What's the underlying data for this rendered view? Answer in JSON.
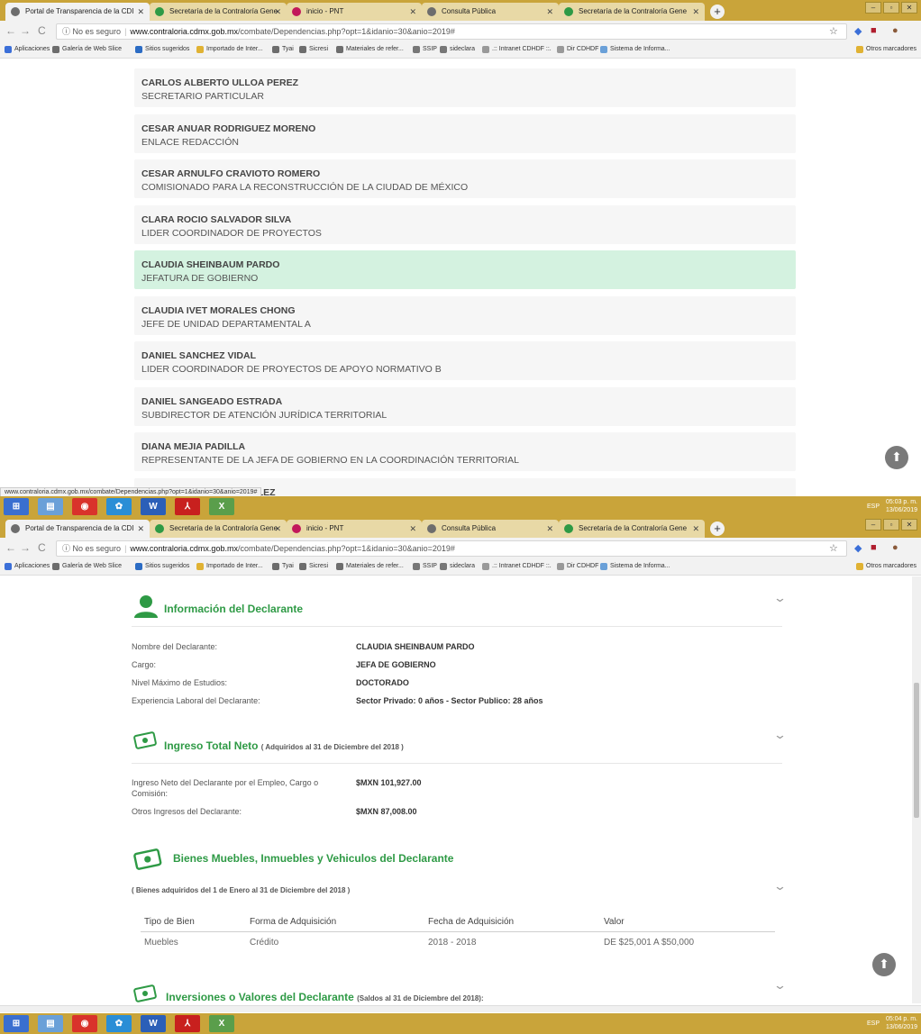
{
  "browser": {
    "tabs": [
      {
        "label": "Portal de Transparencia de la CDI",
        "fav": "#6d6d6d"
      },
      {
        "label": "Secretaría de la Contraloría Gene",
        "fav": "#2e9a45"
      },
      {
        "label": "inicio - PNT",
        "fav": "#c2185b"
      },
      {
        "label": "Consulta Pública",
        "fav": "#6d6d6d"
      },
      {
        "label": "Secretaría de la Contraloría Gene",
        "fav": "#2e9a45"
      }
    ],
    "url_security": "No es seguro",
    "url_host": "www.contraloria.cdmx.gob.mx",
    "url_path": "/combate/Dependencias.php?opt=1&idanio=30&anio=2019#",
    "bookmarks": [
      "Aplicaciones",
      "Galería de Web Slice",
      "Sitios sugeridos",
      "Importado de Inter...",
      "Tyai",
      "Sicresi",
      "Materiales de refer...",
      "SSIP",
      "sideclara",
      ".:: Intranet CDHDF ::.",
      "Dir CDHDF",
      "Sistema de Informa..."
    ],
    "other_bookmarks": "Otros marcadores",
    "status_url": "www.contraloria.cdmx.gob.mx/combate/Dependencias.php?opt=1&idanio=30&anio=2019#"
  },
  "taskbar": {
    "lang": "ESP",
    "time1": "05:03 p. m.",
    "date1": "13/06/2019",
    "time2": "05:04 p. m.",
    "date2": "13/06/2019"
  },
  "people": [
    {
      "name": "CARLOS ALBERTO ULLOA PEREZ",
      "role": "SECRETARIO PARTICULAR",
      "highlight": false
    },
    {
      "name": "CESAR ANUAR RODRIGUEZ MORENO",
      "role": "ENLACE REDACCIÓN",
      "highlight": false
    },
    {
      "name": "CESAR ARNULFO CRAVIOTO ROMERO",
      "role": "COMISIONADO PARA LA RECONSTRUCCIÓN DE LA CIUDAD DE MÉXICO",
      "highlight": false
    },
    {
      "name": "CLARA ROCIO SALVADOR SILVA",
      "role": "LIDER COORDINADOR DE PROYECTOS",
      "highlight": false
    },
    {
      "name": "CLAUDIA SHEINBAUM PARDO",
      "role": "JEFATURA DE GOBIERNO",
      "highlight": true
    },
    {
      "name": "CLAUDIA IVET MORALES CHONG",
      "role": "JEFE DE UNIDAD DEPARTAMENTAL A",
      "highlight": false
    },
    {
      "name": "DANIEL SANCHEZ VIDAL",
      "role": "LIDER COORDINADOR DE PROYECTOS DE APOYO NORMATIVO B",
      "highlight": false
    },
    {
      "name": "DANIEL SANGEADO ESTRADA",
      "role": "SUBDIRECTOR DE ATENCIÓN JURÍDICA TERRITORIAL",
      "highlight": false
    },
    {
      "name": "DIANA MEJIA PADILLA",
      "role": "REPRESENTANTE DE LA JEFA DE GOBIERNO EN LA COORDINACIÓN TERRITORIAL",
      "highlight": false
    },
    {
      "name": "DIANA ALARCON GONZALEZ",
      "role": "",
      "highlight": false
    }
  ],
  "info": {
    "title": "Información del Declarante",
    "rows": [
      {
        "label": "Nombre del Declarante:",
        "value": "CLAUDIA SHEINBAUM PARDO"
      },
      {
        "label": "Cargo:",
        "value": "JEFA DE GOBIERNO"
      },
      {
        "label": "Nivel Máximo de Estudios:",
        "value": "DOCTORADO"
      },
      {
        "label": "Experiencia Laboral del Declarante:",
        "value": "Sector Privado: 0 años - Sector Publico: 28 años"
      }
    ]
  },
  "ingreso": {
    "title": "Ingreso Total Neto",
    "subtitle": "( Adquiridos al 31 de Diciembre del 2018 )",
    "row1_label_a": "Ingreso Neto del Declarante por el Empleo, Cargo o",
    "row1_label_b": "Comisión:",
    "row1_value": "$MXN 101,927.00",
    "row2_label": "Otros Ingresos del Declarante:",
    "row2_value": "$MXN 87,008.00"
  },
  "bienes": {
    "title": "Bienes Muebles, Inmuebles y Vehiculos del Declarante",
    "subtitle": "( Bienes adquiridos del 1 de Enero al 31 de Diciembre del 2018 )",
    "headers": [
      "Tipo de Bien",
      "Forma de Adquisición",
      "Fecha de Adquisición",
      "Valor"
    ],
    "row": [
      "Muebles",
      "Crédito",
      "2018 - 2018",
      "DE $25,001 A $50,000"
    ]
  },
  "inversiones": {
    "title": "Inversiones o Valores del Declarante",
    "subtitle": "(Saldos al 31 de Diciembre del 2018):"
  }
}
